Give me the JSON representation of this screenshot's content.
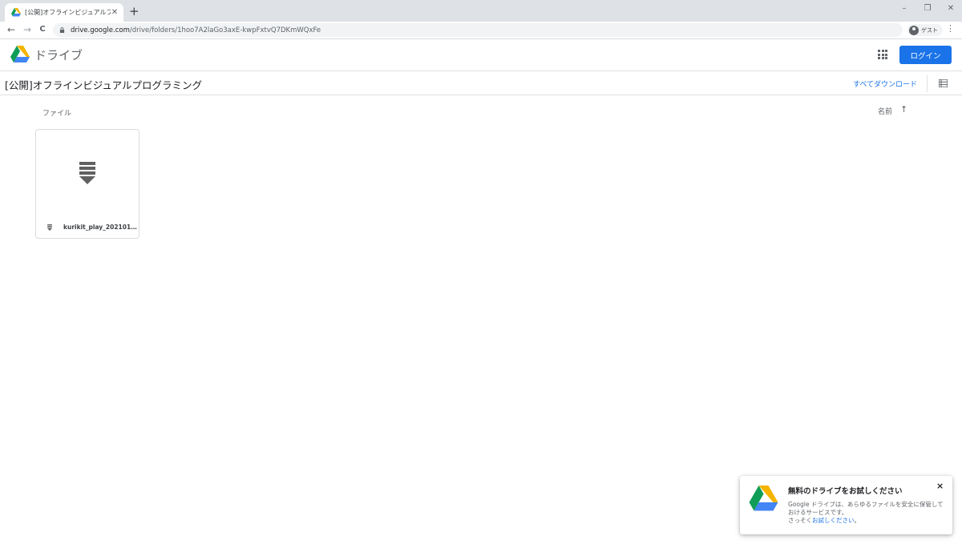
{
  "browser": {
    "tab_title": "[公開]オフラインビジュアルプログラミ",
    "tab_close": "✕",
    "new_tab": "+",
    "url_host": "drive.google.com",
    "url_path": "/drive/folders/1hoo7A2laGo3axE-kwpFxtvQ7DKmWQxFe",
    "profile_label": "ゲスト",
    "window_controls": {
      "minimize": "–",
      "restore": "❐",
      "close": "✕"
    },
    "nav": {
      "back": "←",
      "forward": "→",
      "reload": "C",
      "menu": "⋮"
    }
  },
  "header": {
    "app_name": "ドライブ",
    "login_label": "ログイン"
  },
  "folder": {
    "title": "[公開]オフラインビジュアルプログラミング",
    "download_all": "すべてダウンロード"
  },
  "content": {
    "section_label": "ファイル",
    "sort_label": "名前",
    "sort_arrow": "↑",
    "files": [
      {
        "name": "kurikit_play_2021012...",
        "icon": "download-icon"
      }
    ]
  },
  "promo": {
    "title": "無料のドライブをお試しください",
    "close": "×",
    "body": "Google ドライブは、あらゆるファイルを安全に保管しておけるサービスです。",
    "cta_prefix": "さっそく",
    "cta_link": "お試しください",
    "cta_suffix": "。"
  },
  "colors": {
    "accent": "#1a73e8",
    "drive_green": "#0f9d58",
    "drive_yellow": "#f4b400",
    "drive_blue": "#4285f4",
    "drive_red": "#db4437"
  }
}
